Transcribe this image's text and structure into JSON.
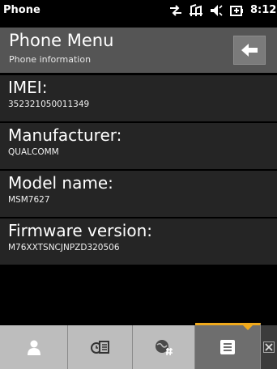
{
  "status_bar": {
    "app_title": "Phone",
    "time": "8:12",
    "icons": [
      "sync-icon",
      "signal-icon",
      "volume-icon",
      "battery-icon"
    ]
  },
  "header": {
    "title": "Phone Menu",
    "subtitle": "Phone information",
    "back_icon": "arrow-left-icon"
  },
  "info_rows": [
    {
      "label": "IMEI:",
      "value": "352321050011349"
    },
    {
      "label": "Manufacturer:",
      "value": "QUALCOMM"
    },
    {
      "label": "Model name:",
      "value": "MSM7627"
    },
    {
      "label": "Firmware version:",
      "value": "M76XXTSNCJNPZD320506"
    }
  ],
  "tab_bar": {
    "tabs": [
      {
        "icon": "person-icon",
        "active": false
      },
      {
        "icon": "phone-list-icon",
        "active": false
      },
      {
        "icon": "globe-settings-icon",
        "active": false
      },
      {
        "icon": "menu-list-icon",
        "active": true
      }
    ],
    "close_icon": "close-icon"
  },
  "colors": {
    "accent": "#f0a91c",
    "header_bg": "#555555",
    "row_bg": "#252525",
    "tab_bg": "#bdbdbd",
    "tab_active_bg": "#6e6e6e"
  }
}
